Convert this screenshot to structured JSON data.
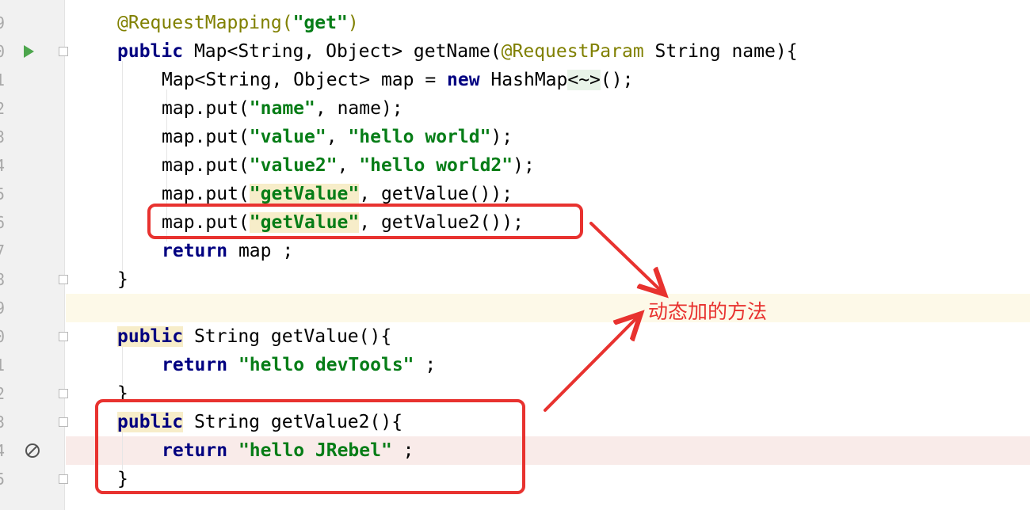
{
  "gutter": {
    "line_numbers": [
      "9",
      "0",
      "1",
      "2",
      "3",
      "4",
      "5",
      "6",
      "7",
      "8",
      "9",
      "0",
      "1",
      "2",
      "3",
      "4",
      "5"
    ]
  },
  "code": {
    "lines": [
      [
        {
          "t": "@RequestMapping(",
          "c": "ann"
        },
        {
          "t": "\"get\"",
          "c": "str"
        },
        {
          "t": ")",
          "c": "ann"
        }
      ],
      [
        {
          "t": "public",
          "c": "kw"
        },
        {
          "t": " Map<String, Object> getName("
        },
        {
          "t": "@RequestParam",
          "c": "ann"
        },
        {
          "t": " String name){"
        }
      ],
      [
        {
          "t": "Map<String, Object> map = "
        },
        {
          "t": "new",
          "c": "kw"
        },
        {
          "t": " HashMap"
        },
        {
          "t": "<~>",
          "c": "hlg"
        },
        {
          "t": "();"
        }
      ],
      [
        {
          "t": "map.put("
        },
        {
          "t": "\"name\"",
          "c": "str"
        },
        {
          "t": ", name);"
        }
      ],
      [
        {
          "t": "map.put("
        },
        {
          "t": "\"value\"",
          "c": "str"
        },
        {
          "t": ", "
        },
        {
          "t": "\"hello world\"",
          "c": "str"
        },
        {
          "t": ");"
        }
      ],
      [
        {
          "t": "map.put("
        },
        {
          "t": "\"value2\"",
          "c": "str"
        },
        {
          "t": ", "
        },
        {
          "t": "\"hello world2\"",
          "c": "str"
        },
        {
          "t": ");"
        }
      ],
      [
        {
          "t": "map.put("
        },
        {
          "t": "\"getValue\"",
          "c": "str hlw"
        },
        {
          "t": ", getValue());"
        }
      ],
      [
        {
          "t": "map.put("
        },
        {
          "t": "\"getValue\"",
          "c": "str hlw"
        },
        {
          "t": ", getValue2());"
        }
      ],
      [
        {
          "t": "return",
          "c": "kw"
        },
        {
          "t": " map ;"
        }
      ],
      [
        {
          "t": "}"
        }
      ],
      [],
      [
        {
          "t": "public",
          "c": "kw hlw"
        },
        {
          "t": " String getValue(){"
        }
      ],
      [
        {
          "t": "return",
          "c": "kw"
        },
        {
          "t": " "
        },
        {
          "t": "\"hello devTools\"",
          "c": "str"
        },
        {
          "t": " ;"
        }
      ],
      [
        {
          "t": "}"
        }
      ],
      [
        {
          "t": "public",
          "c": "kw hlw"
        },
        {
          "t": " String getValue2(){"
        }
      ],
      [
        {
          "t": "return",
          "c": "kw"
        },
        {
          "t": " "
        },
        {
          "t": "\"hello JRebel\"",
          "c": "str"
        },
        {
          "t": " ;"
        }
      ],
      [
        {
          "t": "}"
        }
      ]
    ]
  },
  "annotation": {
    "callout_text": "动态加的方法",
    "color": "#e8322f"
  },
  "colors": {
    "keyword": "#000080",
    "string": "#067d17",
    "annotation": "#808000",
    "current_line": "#fdf9e8",
    "error_line": "#f9ebe9",
    "gutter_bg": "#f1f1f1"
  }
}
